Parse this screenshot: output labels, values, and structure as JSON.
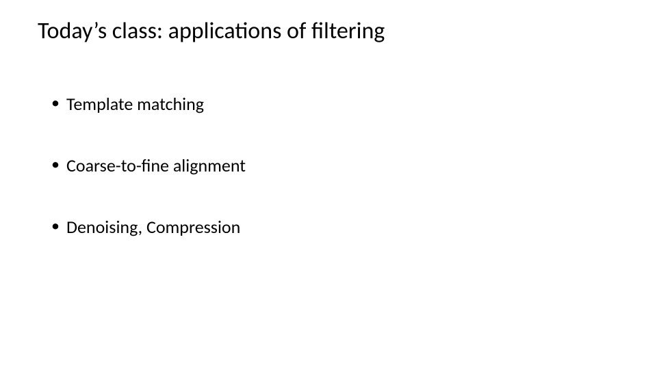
{
  "slide": {
    "title": "Today’s class: applications of filtering",
    "bullets": [
      "Template matching",
      "Coarse-to-fine alignment",
      "Denoising, Compression"
    ]
  }
}
